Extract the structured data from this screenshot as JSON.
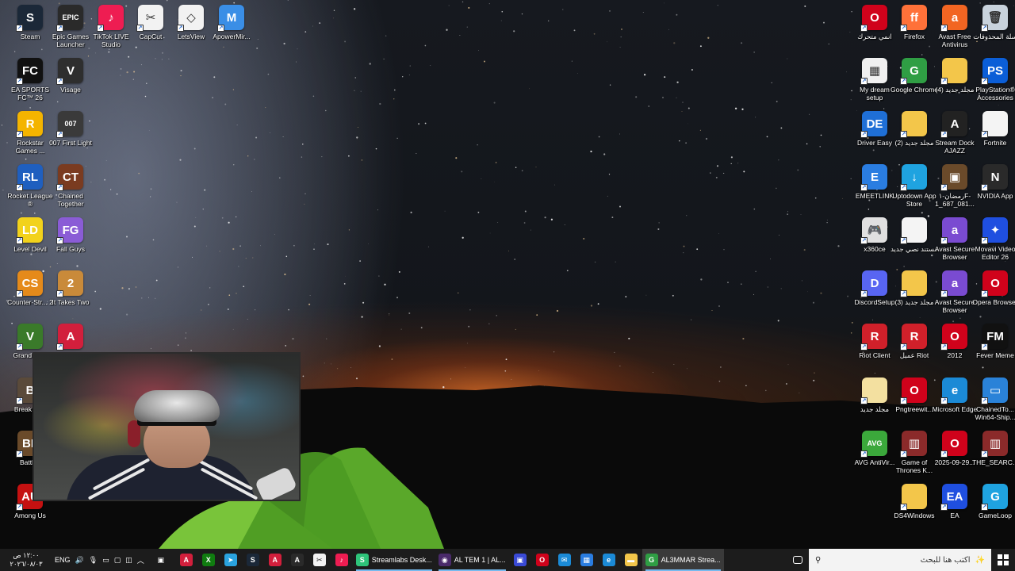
{
  "desktop_icons_left": [
    {
      "id": "steam",
      "label": "Steam",
      "color": "#1b2838",
      "glyph": "S"
    },
    {
      "id": "epic",
      "label": "Epic Games Launcher",
      "color": "#2a2a2a",
      "glyph": "EPIC"
    },
    {
      "id": "tiktok-live",
      "label": "TikTok LIVE Studio",
      "color": "#ee1d52",
      "glyph": "♪"
    },
    {
      "id": "capcut",
      "label": "CapCut",
      "color": "#f2f2f2",
      "glyph": "✂"
    },
    {
      "id": "letsview",
      "label": "LetsView",
      "color": "#f2f2f2",
      "glyph": "◇"
    },
    {
      "id": "apowermirror",
      "label": "ApowerMir...",
      "color": "#3a8ee6",
      "glyph": "M"
    },
    {
      "id": "ea-fc",
      "label": "EA SPORTS FC™ 26",
      "color": "#111111",
      "glyph": "FC"
    },
    {
      "id": "visage",
      "label": "Visage",
      "color": "#2e2e2e",
      "glyph": "V"
    },
    {
      "id": "rockstar",
      "label": "Rockstar Games ...",
      "color": "#f4b400",
      "glyph": "R"
    },
    {
      "id": "007",
      "label": "007 First Light",
      "color": "#3a3a3a",
      "glyph": "007"
    },
    {
      "id": "rocket-league",
      "label": "Rocket League ®",
      "color": "#1f5fbf",
      "glyph": "RL"
    },
    {
      "id": "chained",
      "label": "Chained Together",
      "color": "#7a3b20",
      "glyph": "CT"
    },
    {
      "id": "level-devil",
      "label": "Level Devil",
      "color": "#f2d21b",
      "glyph": "LD"
    },
    {
      "id": "fall-guys",
      "label": "Fall Guys",
      "color": "#8a5cd6",
      "glyph": "FG"
    },
    {
      "id": "counter-strike",
      "label": "Counter-Str... 2",
      "color": "#e58a1a",
      "glyph": "CS"
    },
    {
      "id": "it-takes-two",
      "label": "It Takes Two",
      "color": "#c98a3a",
      "glyph": "2"
    },
    {
      "id": "gta",
      "label": "Grand Auto",
      "color": "#3a7a2a",
      "glyph": "V"
    },
    {
      "id": "stream-dock-2",
      "label": "",
      "color": "#d21f3c",
      "glyph": "A"
    },
    {
      "id": "break",
      "label": "Break Cha",
      "color": "#5a4a3a",
      "glyph": "B"
    },
    {
      "id": "battlefield",
      "label": "Battlefi",
      "color": "#6a4a2a",
      "glyph": "BF"
    },
    {
      "id": "among-us",
      "label": "Among Us",
      "color": "#c51111",
      "glyph": "AU"
    }
  ],
  "desktop_icons_right": [
    {
      "id": "anime",
      "label": "انمي متحرك",
      "color": "#d0021b",
      "glyph": "O"
    },
    {
      "id": "firefox",
      "label": "Firefox",
      "color": "#ff7139",
      "glyph": "ff"
    },
    {
      "id": "avast-antivirus",
      "label": "Avast Free Antivirus",
      "color": "#f26522",
      "glyph": "a"
    },
    {
      "id": "recycle-bin",
      "label": "سلة المحذوفات",
      "color": "#c8d2dc",
      "glyph": "🗑"
    },
    {
      "id": "my-dream",
      "label": "My dream setup",
      "color": "#f0f0f0",
      "glyph": "▦"
    },
    {
      "id": "chrome",
      "label": "Google Chrome",
      "color": "#2f9e44",
      "glyph": "G"
    },
    {
      "id": "folder-4",
      "label": "(4) مجلد جديد",
      "color": "#f3c64a",
      "glyph": ""
    },
    {
      "id": "ps-accessories",
      "label": "PlayStation® Accessories",
      "color": "#0b5ed7",
      "glyph": "PS"
    },
    {
      "id": "driver-easy",
      "label": "Driver Easy",
      "color": "#1f6fd6",
      "glyph": "DE"
    },
    {
      "id": "folder-2",
      "label": "(2) مجلد جديد",
      "color": "#f3c64a",
      "glyph": ""
    },
    {
      "id": "stream-dock",
      "label": "Stream Dock AJAZZ",
      "color": "#222222",
      "glyph": "A"
    },
    {
      "id": "fortnite",
      "label": "Fortnite",
      "color": "#f4f4f4",
      "glyph": ""
    },
    {
      "id": "emeetlink",
      "label": "EMEETLINK",
      "color": "#2a7de1",
      "glyph": "E"
    },
    {
      "id": "uptodown",
      "label": "Uptodown App Store",
      "color": "#1fa3e0",
      "glyph": "↓"
    },
    {
      "id": "ramadan",
      "label": "رمضان-١F-1_687_081...",
      "color": "#6a4a2a",
      "glyph": "▣"
    },
    {
      "id": "nvidia",
      "label": "NVIDIA App",
      "color": "#2a2a2a",
      "glyph": "N"
    },
    {
      "id": "x360ce",
      "label": "x360ce",
      "color": "#e0e0e0",
      "glyph": "🎮"
    },
    {
      "id": "new-doc",
      "label": "مستند نصي جديد",
      "color": "#f4f4f4",
      "glyph": ""
    },
    {
      "id": "avast-browser-1",
      "label": "Avast Secure Browser",
      "color": "#7a4bd1",
      "glyph": "a"
    },
    {
      "id": "movavi",
      "label": "Movavi Video Editor 26",
      "color": "#1f4fe0",
      "glyph": "✦"
    },
    {
      "id": "discord",
      "label": "DiscordSetup",
      "color": "#5865f2",
      "glyph": "D"
    },
    {
      "id": "folder-3",
      "label": "(3) مجلد جديد",
      "color": "#f3c64a",
      "glyph": ""
    },
    {
      "id": "avast-browser-2",
      "label": "Avast Secure Browser",
      "color": "#7a4bd1",
      "glyph": "a"
    },
    {
      "id": "opera",
      "label": "Opera Browser",
      "color": "#d0021b",
      "glyph": "O"
    },
    {
      "id": "riot-client",
      "label": "Riot Client",
      "color": "#d0202a",
      "glyph": "R"
    },
    {
      "id": "riot-client-ar",
      "label": "عميل Riot",
      "color": "#d0202a",
      "glyph": "R"
    },
    {
      "id": "2012",
      "label": "2012",
      "color": "#d0021b",
      "glyph": "O"
    },
    {
      "id": "fever-meme",
      "label": "Fever Meme",
      "color": "#111111",
      "glyph": "FM"
    },
    {
      "id": "folder-new",
      "label": "مجلد جديد",
      "color": "#f3e0a0",
      "glyph": ""
    },
    {
      "id": "pngtree",
      "label": "Pngtreewit...",
      "color": "#d0021b",
      "glyph": "O"
    },
    {
      "id": "edge",
      "label": "Microsoft Edge",
      "color": "#1b8ad6",
      "glyph": "e"
    },
    {
      "id": "chained-win64",
      "label": "ChainedTo... Win64-Ship...",
      "color": "#2a82d8",
      "glyph": "▭"
    },
    {
      "id": "avg",
      "label": "AVG AntiVir...",
      "color": "#3ba83b",
      "glyph": "AVG"
    },
    {
      "id": "got",
      "label": "Game of Thrones K...",
      "color": "#8b2a2a",
      "glyph": "▥"
    },
    {
      "id": "2025",
      "label": "2025-09-29...",
      "color": "#d0021b",
      "glyph": "O"
    },
    {
      "id": "the-search",
      "label": "THE_SEARC...",
      "color": "#8b2a2a",
      "glyph": "▥"
    },
    {
      "id": "ds4windows",
      "label": "DS4Windows",
      "color": "#f3c64a",
      "glyph": ""
    },
    {
      "id": "ea",
      "label": "EA",
      "color": "#1f4fe0",
      "glyph": "EA"
    },
    {
      "id": "gameloop",
      "label": "GameLoop",
      "color": "#1fa3e0",
      "glyph": "G"
    }
  ],
  "taskbar": {
    "start_icon": "windows-logo",
    "search_placeholder": "اكتب هنا للبحث",
    "task_view": "task-view",
    "apps": [
      {
        "id": "chrome-task",
        "label": "AL3MMAR Strea...",
        "color": "#2f9e44",
        "glyph": "G",
        "active": true
      },
      {
        "id": "explorer",
        "label": "",
        "color": "#f3c64a",
        "glyph": "▬"
      },
      {
        "id": "edge-task",
        "label": "",
        "color": "#1b8ad6",
        "glyph": "e"
      },
      {
        "id": "store",
        "label": "",
        "color": "#2a7de1",
        "glyph": "▦"
      },
      {
        "id": "mail",
        "label": "",
        "color": "#1b8ad6",
        "glyph": "✉"
      },
      {
        "id": "opera-task",
        "label": "",
        "color": "#d0021b",
        "glyph": "O"
      },
      {
        "id": "app-blue",
        "label": "",
        "color": "#3a4ad6",
        "glyph": "▣"
      },
      {
        "id": "obs-task",
        "label": "AL TEM 1 | AL...",
        "color": "#4a2a6a",
        "glyph": "◉"
      },
      {
        "id": "streamlabs",
        "label": "Streamlabs Desk...",
        "color": "#2ec47a",
        "glyph": "S"
      },
      {
        "id": "tiktok-task",
        "label": "",
        "color": "#ee1d52",
        "glyph": "♪"
      },
      {
        "id": "capcut-task",
        "label": "",
        "color": "#f2f2f2",
        "glyph": "✂"
      },
      {
        "id": "ajazz-task",
        "label": "",
        "color": "#2a2a2a",
        "glyph": "A"
      },
      {
        "id": "stream-dock-task",
        "label": "",
        "color": "#d21f3c",
        "glyph": "A"
      },
      {
        "id": "steam-task",
        "label": "",
        "color": "#1b2838",
        "glyph": "S"
      },
      {
        "id": "telegram",
        "label": "",
        "color": "#2aa3df",
        "glyph": "➤"
      },
      {
        "id": "xbox",
        "label": "",
        "color": "#107c10",
        "glyph": "X"
      },
      {
        "id": "stream-dock-task-2",
        "label": "",
        "color": "#d21f3c",
        "glyph": "A"
      }
    ],
    "tray": {
      "keyboard": "▣",
      "lang": "ENG",
      "time": "١٢:٠٠ ص",
      "date": "٢٠٢٦/٠٨/٠٣"
    }
  }
}
